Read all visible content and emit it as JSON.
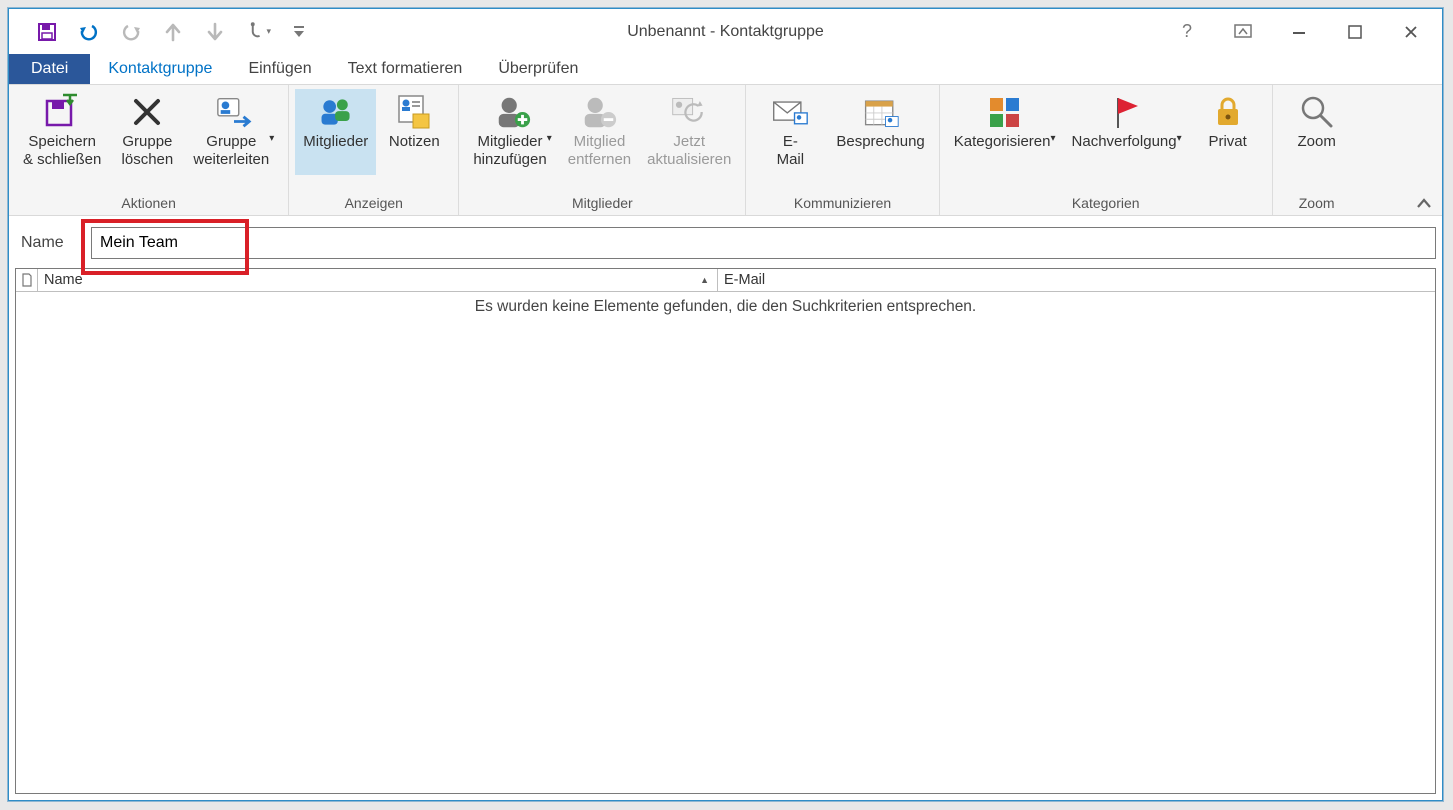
{
  "window": {
    "title": "Unbenannt - Kontaktgruppe"
  },
  "tabs": {
    "file": "Datei",
    "contactgroup": "Kontaktgruppe",
    "insert": "Einfügen",
    "formattext": "Text formatieren",
    "review": "Überprüfen"
  },
  "ribbon": {
    "groups": {
      "actions": {
        "title": "Aktionen"
      },
      "show": {
        "title": "Anzeigen"
      },
      "members": {
        "title": "Mitglieder"
      },
      "communicate": {
        "title": "Kommunizieren"
      },
      "categories": {
        "title": "Kategorien"
      },
      "zoom": {
        "title": "Zoom"
      }
    },
    "buttons": {
      "saveclose": "Speichern\n& schließen",
      "deletegroup": "Gruppe\nlöschen",
      "forwardgroup": "Gruppe\nweiterleiten",
      "members_btn": "Mitglieder",
      "notes": "Notizen",
      "addmembers": "Mitglieder\nhinzufügen",
      "removemember": "Mitglied\nentfernen",
      "updatenow": "Jetzt\naktualisieren",
      "email": "E-\nMail",
      "meeting": "Besprechung",
      "categorize": "Kategorisieren",
      "followup": "Nachverfolgung",
      "private": "Privat",
      "zoom": "Zoom"
    }
  },
  "body": {
    "name_label": "Name",
    "name_value": "Mein Team",
    "columns": {
      "name": "Name",
      "email": "E-Mail"
    },
    "empty_message": "Es wurden keine Elemente gefunden, die den Suchkriterien entsprechen."
  }
}
